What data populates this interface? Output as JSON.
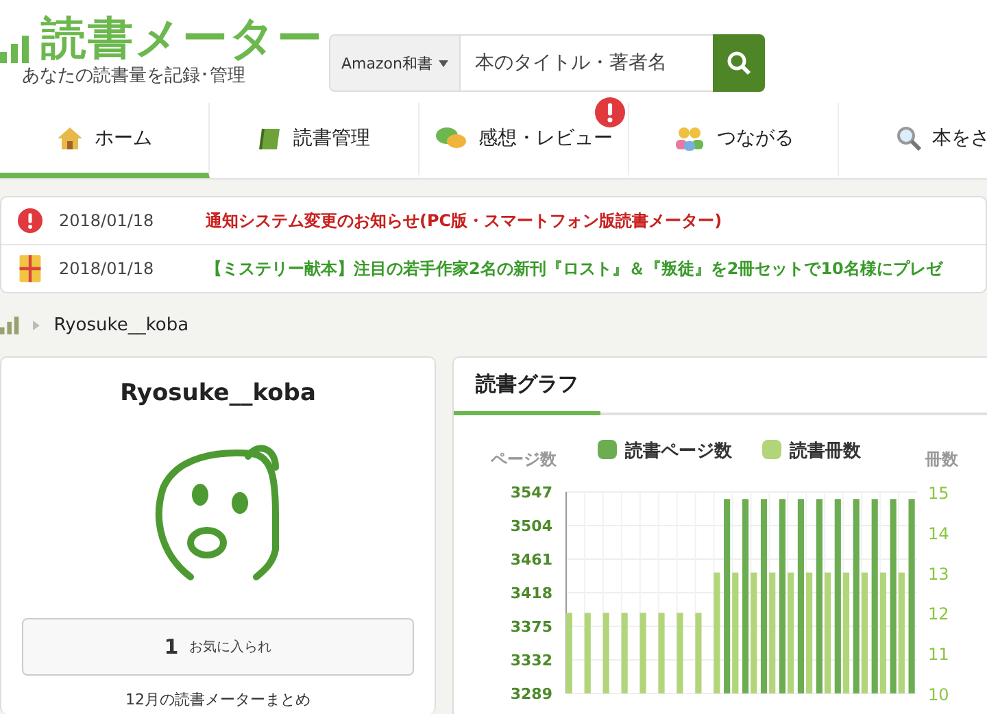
{
  "header": {
    "logo": "読書メーター",
    "tagline": "あなたの読書量を記録･管理",
    "search": {
      "scope": "Amazon和書",
      "placeholder": "本のタイトル・著者名"
    }
  },
  "nav": [
    {
      "label": "ホーム",
      "selected": true,
      "alert": false
    },
    {
      "label": "読書管理",
      "selected": false,
      "alert": false
    },
    {
      "label": "感想・レビュー",
      "selected": false,
      "alert": true
    },
    {
      "label": "つながる",
      "selected": false,
      "alert": false
    },
    {
      "label": "本をさ",
      "selected": false,
      "alert": false
    }
  ],
  "notices": [
    {
      "kind": "alert",
      "date": "2018/01/18",
      "text": "通知システム変更のお知らせ(PC版・スマートフォン版読書メーター)",
      "color": "#c8201e"
    },
    {
      "kind": "gift",
      "date": "2018/01/18",
      "text": "【ミステリー献本】注目の若手作家2名の新刊『ロスト』＆『叛徒』を2冊セットで10名様にプレゼ",
      "color": "#3a9a2a"
    }
  ],
  "breadcrumb": "Ryosuke__koba",
  "profile": {
    "name": "Ryosuke__koba",
    "favorites_count": "1",
    "favorites_label": "お気に入られ",
    "summary_link": "12月の読書メーターまとめ"
  },
  "graph": {
    "title": "読書グラフ",
    "chart_data": {
      "type": "bar",
      "ylabel": "ページ数",
      "grid": true,
      "legend": "top",
      "y2label": "冊数",
      "series": [
        {
          "name": "読書ページ数",
          "color": "#6cad52",
          "values": [
            null,
            null,
            null,
            null,
            null,
            null,
            null,
            null,
            3538,
            3538,
            3538,
            3538,
            3538,
            3538,
            3538,
            3538,
            3538,
            3538,
            3538
          ]
        },
        {
          "name": "読書冊数",
          "color": "#b2d57a",
          "axis": "y2",
          "values": [
            12,
            12,
            12,
            12,
            12,
            12,
            12,
            12,
            13,
            13,
            13,
            13,
            13,
            13,
            13,
            13,
            13,
            13,
            13
          ]
        }
      ],
      "ylim": [
        3289,
        3547
      ],
      "yticks": [
        3289,
        3332,
        3375,
        3418,
        3461,
        3504,
        3547
      ],
      "y2lim": [
        10,
        15
      ],
      "y2ticks": [
        10,
        11,
        12,
        13,
        14,
        15
      ]
    }
  }
}
